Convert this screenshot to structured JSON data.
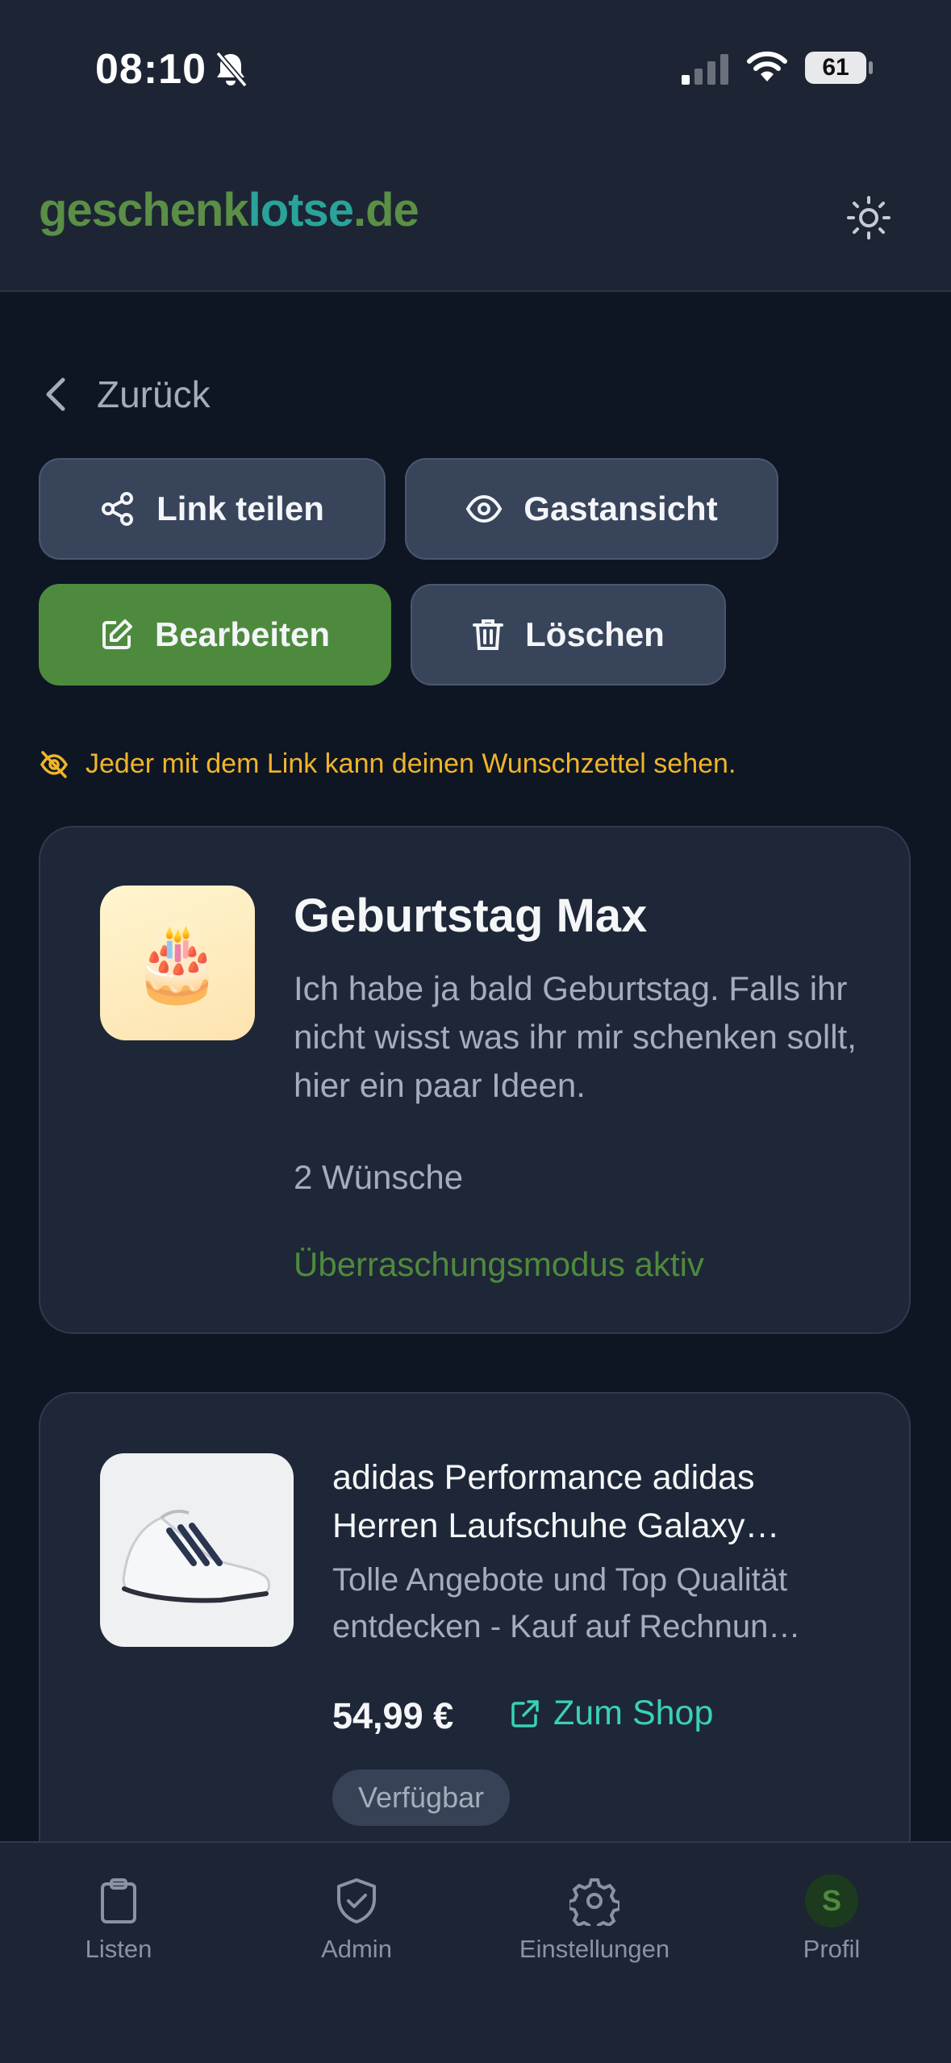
{
  "status_bar": {
    "time": "08:10",
    "battery": "61",
    "icons": [
      "bell-slash-icon",
      "signal-icon",
      "wifi-icon",
      "battery-icon"
    ]
  },
  "header": {
    "logo_part1": "geschenk",
    "logo_part2": "lotse",
    "logo_part3": ".de",
    "theme_icon": "sun-icon"
  },
  "nav": {
    "back_label": "Zurück"
  },
  "actions": {
    "share_label": "Link teilen",
    "guest_label": "Gastansicht",
    "edit_label": "Bearbeiten",
    "delete_label": "Löschen"
  },
  "notice": {
    "text": "Jeder mit dem Link kann deinen Wunschzettel sehen.",
    "icon": "eye-slash-icon"
  },
  "wishlist": {
    "emoji": "🎂",
    "title": "Geburtstag Max",
    "description": "Ich habe ja bald Geburtstag. Falls ihr nicht wisst was ihr mir schenken sollt, hier ein paar Ideen.",
    "count": "2 Wünsche",
    "mode": "Überraschungsmodus aktiv"
  },
  "items": [
    {
      "title": "adidas Performance adidas Herren Laufschuhe Galaxy…",
      "description": "Tolle Angebote und Top Qualität entdecken - Kauf auf Rechnun…",
      "price": "54,99 €",
      "shop_label": "Zum Shop",
      "status": "Verfügbar"
    }
  ],
  "tabbar": {
    "tabs": [
      {
        "label": "Listen",
        "icon": "clipboard-icon"
      },
      {
        "label": "Admin",
        "icon": "shield-check-icon"
      },
      {
        "label": "Einstellungen",
        "icon": "gear-icon"
      },
      {
        "label": "Profil",
        "avatar_letter": "S"
      }
    ]
  },
  "colors": {
    "accent_green": "#4e8a3e",
    "accent_teal": "#39d1b8",
    "warning": "#f0b429",
    "background": "#0e1624"
  }
}
